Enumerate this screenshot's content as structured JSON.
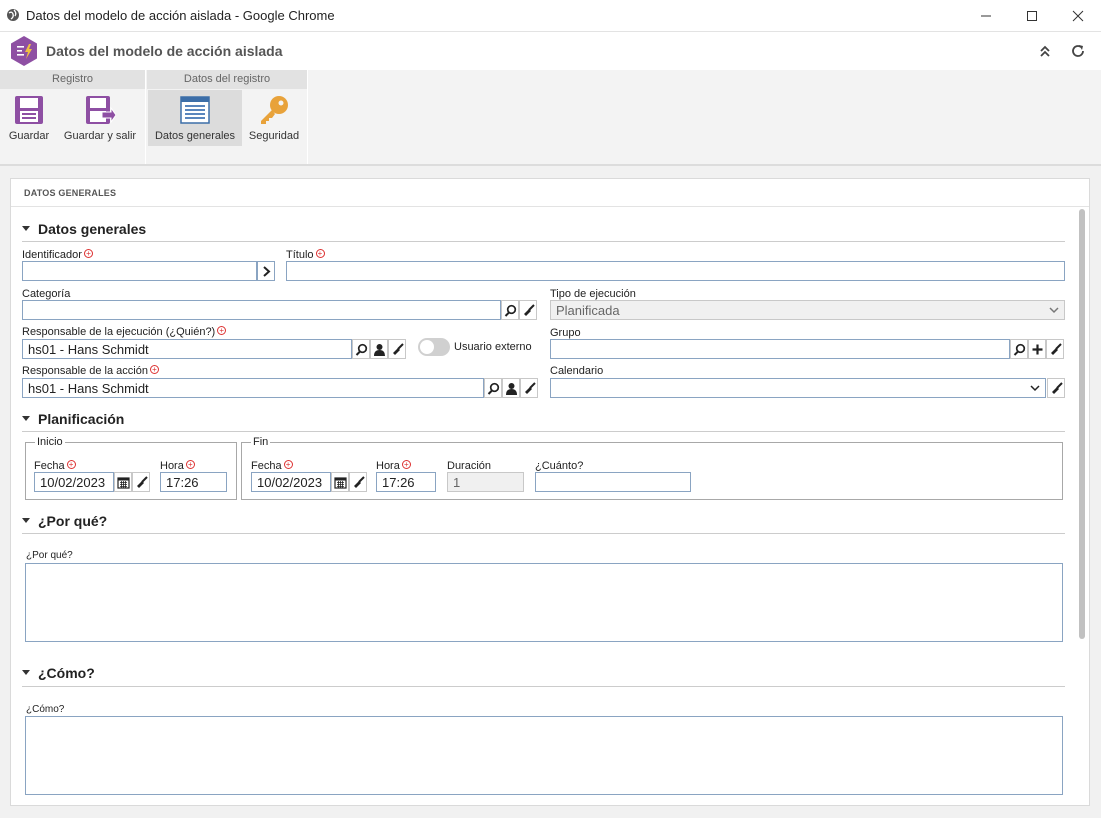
{
  "window": {
    "title": "Datos del modelo de acción aislada - Google Chrome"
  },
  "app": {
    "title": "Datos del modelo de acción aislada"
  },
  "ribbon": {
    "groups": [
      {
        "label": "Registro",
        "buttons": [
          {
            "label": "Guardar"
          },
          {
            "label": "Guardar y salir"
          }
        ]
      },
      {
        "label": "Datos del registro",
        "buttons": [
          {
            "label": "Datos generales"
          },
          {
            "label": "Seguridad"
          }
        ]
      }
    ]
  },
  "panel": {
    "header": "DATOS GENERALES"
  },
  "sections": {
    "general": "Datos generales",
    "planning": "Planificación",
    "why": "¿Por qué?",
    "how": "¿Cómo?"
  },
  "fields": {
    "identifier": {
      "label": "Identificador",
      "value": ""
    },
    "title": {
      "label": "Título",
      "value": ""
    },
    "category": {
      "label": "Categoría",
      "value": ""
    },
    "execution_type": {
      "label": "Tipo de ejecución",
      "value": "Planificada"
    },
    "exec_responsible": {
      "label": "Responsable de la ejecución (¿Quién?)",
      "value": "hs01 - Hans Schmidt"
    },
    "external_user": {
      "label": "Usuario externo",
      "on": false
    },
    "group": {
      "label": "Grupo",
      "value": ""
    },
    "action_responsible": {
      "label": "Responsable de la acción",
      "value": "hs01 - Hans Schmidt"
    },
    "calendar": {
      "label": "Calendario",
      "value": ""
    }
  },
  "planning": {
    "start": {
      "legend": "Inicio",
      "date_label": "Fecha",
      "date": "10/02/2023",
      "time_label": "Hora",
      "time": "17:26"
    },
    "end": {
      "legend": "Fin",
      "date_label": "Fecha",
      "date": "10/02/2023",
      "time_label": "Hora",
      "time": "17:26",
      "duration_label": "Duración",
      "duration": "1",
      "how_much_label": "¿Cuánto?",
      "how_much": ""
    }
  },
  "why": {
    "label": "¿Por qué?",
    "value": ""
  },
  "how": {
    "label": "¿Cómo?",
    "value": ""
  },
  "colors": {
    "brand": "#8e4fa3",
    "accent_key": "#e8a23a",
    "required": "#d33333"
  }
}
